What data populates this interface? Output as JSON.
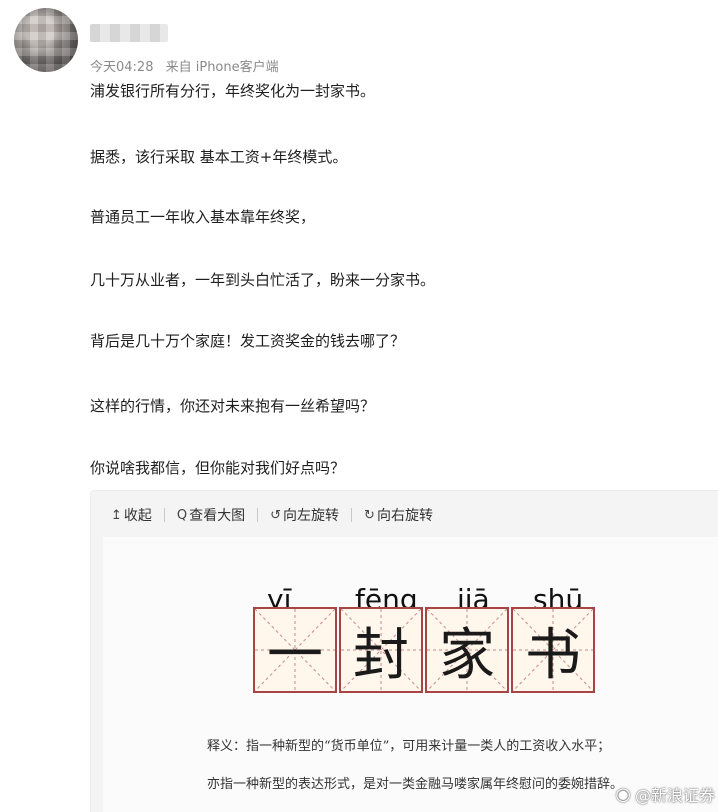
{
  "post": {
    "time": "今天04:28",
    "source": "来自 iPhone客户端",
    "lines": [
      "浦发银行所有分行，年终奖化为一封家书。",
      "据悉，该行采取 基本工资+年终模式。",
      "普通员工一年收入基本靠年终奖，",
      "几十万从业者，一年到头白忙活了，盼来一分家书。",
      "背后是几十万个家庭！发工资奖金的钱去哪了？",
      "这样的行情，你还对未来抱有一丝希望吗？",
      "你说啥我都信，但你能对我们好点吗？"
    ]
  },
  "viewer": {
    "toolbar": {
      "collapse": "收起",
      "view_large": "查看大图",
      "rotate_left": "向左旋转",
      "rotate_right": "向右旋转"
    }
  },
  "image": {
    "pinyin": [
      "yī",
      "fēng",
      "jiā",
      "shū"
    ],
    "chars": [
      "一",
      "封",
      "家",
      "书"
    ],
    "line1": "释义：指一种新型的“货币单位”，可用来计量一类人的工资收入水平；",
    "line2": "亦指一种新型的表达形式，是对一类金融马喽家属年终慰问的委婉措辞。",
    "watermark": "@新浪证券"
  }
}
